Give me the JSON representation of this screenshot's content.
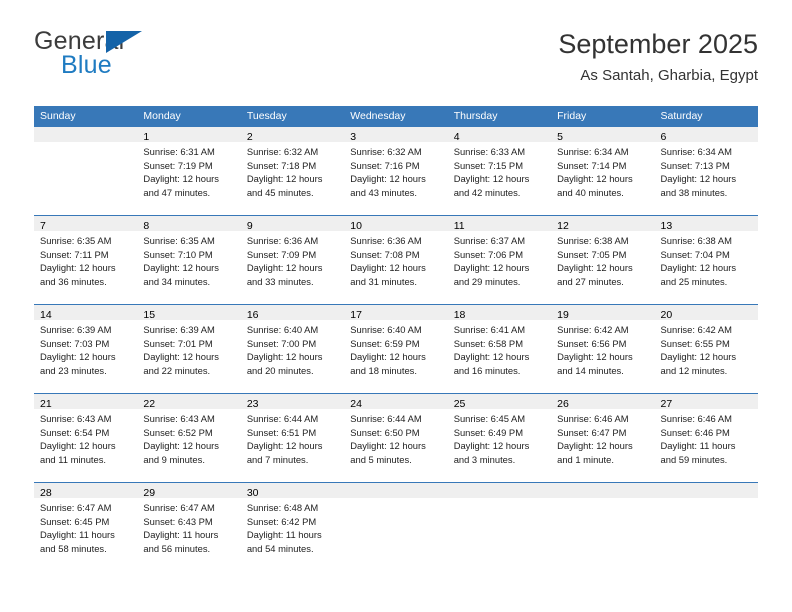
{
  "brand": {
    "name_part1": "General",
    "name_part2": "Blue",
    "flag_color": "#1463a8",
    "blue_text_color": "#1f7bc1"
  },
  "header": {
    "title": "September 2025",
    "subtitle": "As Santah, Gharbia, Egypt"
  },
  "theme": {
    "header_row_bg": "#3878b8",
    "daynum_band_bg": "#efefef",
    "row_separator": "#3878b8"
  },
  "weekday_headers": [
    "Sunday",
    "Monday",
    "Tuesday",
    "Wednesday",
    "Thursday",
    "Friday",
    "Saturday"
  ],
  "weeks": [
    [
      {
        "day": "",
        "sunrise": "",
        "sunset": "",
        "daylight_line1": "",
        "daylight_line2": ""
      },
      {
        "day": "1",
        "sunrise": "Sunrise: 6:31 AM",
        "sunset": "Sunset: 7:19 PM",
        "daylight_line1": "Daylight: 12 hours",
        "daylight_line2": "and 47 minutes."
      },
      {
        "day": "2",
        "sunrise": "Sunrise: 6:32 AM",
        "sunset": "Sunset: 7:18 PM",
        "daylight_line1": "Daylight: 12 hours",
        "daylight_line2": "and 45 minutes."
      },
      {
        "day": "3",
        "sunrise": "Sunrise: 6:32 AM",
        "sunset": "Sunset: 7:16 PM",
        "daylight_line1": "Daylight: 12 hours",
        "daylight_line2": "and 43 minutes."
      },
      {
        "day": "4",
        "sunrise": "Sunrise: 6:33 AM",
        "sunset": "Sunset: 7:15 PM",
        "daylight_line1": "Daylight: 12 hours",
        "daylight_line2": "and 42 minutes."
      },
      {
        "day": "5",
        "sunrise": "Sunrise: 6:34 AM",
        "sunset": "Sunset: 7:14 PM",
        "daylight_line1": "Daylight: 12 hours",
        "daylight_line2": "and 40 minutes."
      },
      {
        "day": "6",
        "sunrise": "Sunrise: 6:34 AM",
        "sunset": "Sunset: 7:13 PM",
        "daylight_line1": "Daylight: 12 hours",
        "daylight_line2": "and 38 minutes."
      }
    ],
    [
      {
        "day": "7",
        "sunrise": "Sunrise: 6:35 AM",
        "sunset": "Sunset: 7:11 PM",
        "daylight_line1": "Daylight: 12 hours",
        "daylight_line2": "and 36 minutes."
      },
      {
        "day": "8",
        "sunrise": "Sunrise: 6:35 AM",
        "sunset": "Sunset: 7:10 PM",
        "daylight_line1": "Daylight: 12 hours",
        "daylight_line2": "and 34 minutes."
      },
      {
        "day": "9",
        "sunrise": "Sunrise: 6:36 AM",
        "sunset": "Sunset: 7:09 PM",
        "daylight_line1": "Daylight: 12 hours",
        "daylight_line2": "and 33 minutes."
      },
      {
        "day": "10",
        "sunrise": "Sunrise: 6:36 AM",
        "sunset": "Sunset: 7:08 PM",
        "daylight_line1": "Daylight: 12 hours",
        "daylight_line2": "and 31 minutes."
      },
      {
        "day": "11",
        "sunrise": "Sunrise: 6:37 AM",
        "sunset": "Sunset: 7:06 PM",
        "daylight_line1": "Daylight: 12 hours",
        "daylight_line2": "and 29 minutes."
      },
      {
        "day": "12",
        "sunrise": "Sunrise: 6:38 AM",
        "sunset": "Sunset: 7:05 PM",
        "daylight_line1": "Daylight: 12 hours",
        "daylight_line2": "and 27 minutes."
      },
      {
        "day": "13",
        "sunrise": "Sunrise: 6:38 AM",
        "sunset": "Sunset: 7:04 PM",
        "daylight_line1": "Daylight: 12 hours",
        "daylight_line2": "and 25 minutes."
      }
    ],
    [
      {
        "day": "14",
        "sunrise": "Sunrise: 6:39 AM",
        "sunset": "Sunset: 7:03 PM",
        "daylight_line1": "Daylight: 12 hours",
        "daylight_line2": "and 23 minutes."
      },
      {
        "day": "15",
        "sunrise": "Sunrise: 6:39 AM",
        "sunset": "Sunset: 7:01 PM",
        "daylight_line1": "Daylight: 12 hours",
        "daylight_line2": "and 22 minutes."
      },
      {
        "day": "16",
        "sunrise": "Sunrise: 6:40 AM",
        "sunset": "Sunset: 7:00 PM",
        "daylight_line1": "Daylight: 12 hours",
        "daylight_line2": "and 20 minutes."
      },
      {
        "day": "17",
        "sunrise": "Sunrise: 6:40 AM",
        "sunset": "Sunset: 6:59 PM",
        "daylight_line1": "Daylight: 12 hours",
        "daylight_line2": "and 18 minutes."
      },
      {
        "day": "18",
        "sunrise": "Sunrise: 6:41 AM",
        "sunset": "Sunset: 6:58 PM",
        "daylight_line1": "Daylight: 12 hours",
        "daylight_line2": "and 16 minutes."
      },
      {
        "day": "19",
        "sunrise": "Sunrise: 6:42 AM",
        "sunset": "Sunset: 6:56 PM",
        "daylight_line1": "Daylight: 12 hours",
        "daylight_line2": "and 14 minutes."
      },
      {
        "day": "20",
        "sunrise": "Sunrise: 6:42 AM",
        "sunset": "Sunset: 6:55 PM",
        "daylight_line1": "Daylight: 12 hours",
        "daylight_line2": "and 12 minutes."
      }
    ],
    [
      {
        "day": "21",
        "sunrise": "Sunrise: 6:43 AM",
        "sunset": "Sunset: 6:54 PM",
        "daylight_line1": "Daylight: 12 hours",
        "daylight_line2": "and 11 minutes."
      },
      {
        "day": "22",
        "sunrise": "Sunrise: 6:43 AM",
        "sunset": "Sunset: 6:52 PM",
        "daylight_line1": "Daylight: 12 hours",
        "daylight_line2": "and 9 minutes."
      },
      {
        "day": "23",
        "sunrise": "Sunrise: 6:44 AM",
        "sunset": "Sunset: 6:51 PM",
        "daylight_line1": "Daylight: 12 hours",
        "daylight_line2": "and 7 minutes."
      },
      {
        "day": "24",
        "sunrise": "Sunrise: 6:44 AM",
        "sunset": "Sunset: 6:50 PM",
        "daylight_line1": "Daylight: 12 hours",
        "daylight_line2": "and 5 minutes."
      },
      {
        "day": "25",
        "sunrise": "Sunrise: 6:45 AM",
        "sunset": "Sunset: 6:49 PM",
        "daylight_line1": "Daylight: 12 hours",
        "daylight_line2": "and 3 minutes."
      },
      {
        "day": "26",
        "sunrise": "Sunrise: 6:46 AM",
        "sunset": "Sunset: 6:47 PM",
        "daylight_line1": "Daylight: 12 hours",
        "daylight_line2": "and 1 minute."
      },
      {
        "day": "27",
        "sunrise": "Sunrise: 6:46 AM",
        "sunset": "Sunset: 6:46 PM",
        "daylight_line1": "Daylight: 11 hours",
        "daylight_line2": "and 59 minutes."
      }
    ],
    [
      {
        "day": "28",
        "sunrise": "Sunrise: 6:47 AM",
        "sunset": "Sunset: 6:45 PM",
        "daylight_line1": "Daylight: 11 hours",
        "daylight_line2": "and 58 minutes."
      },
      {
        "day": "29",
        "sunrise": "Sunrise: 6:47 AM",
        "sunset": "Sunset: 6:43 PM",
        "daylight_line1": "Daylight: 11 hours",
        "daylight_line2": "and 56 minutes."
      },
      {
        "day": "30",
        "sunrise": "Sunrise: 6:48 AM",
        "sunset": "Sunset: 6:42 PM",
        "daylight_line1": "Daylight: 11 hours",
        "daylight_line2": "and 54 minutes."
      },
      {
        "day": "",
        "sunrise": "",
        "sunset": "",
        "daylight_line1": "",
        "daylight_line2": ""
      },
      {
        "day": "",
        "sunrise": "",
        "sunset": "",
        "daylight_line1": "",
        "daylight_line2": ""
      },
      {
        "day": "",
        "sunrise": "",
        "sunset": "",
        "daylight_line1": "",
        "daylight_line2": ""
      },
      {
        "day": "",
        "sunrise": "",
        "sunset": "",
        "daylight_line1": "",
        "daylight_line2": ""
      }
    ]
  ]
}
